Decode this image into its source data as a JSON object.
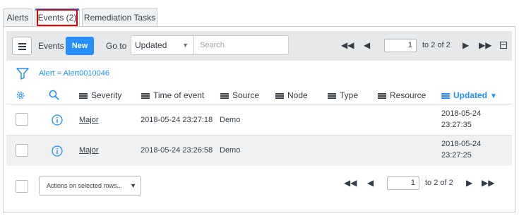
{
  "tabs": [
    {
      "label": "Alerts"
    },
    {
      "label": "Events (2)"
    },
    {
      "label": "Remediation Tasks"
    }
  ],
  "toolbar": {
    "list_title": "Events",
    "new_label": "New",
    "goto_label": "Go to",
    "goto_field": "Updated",
    "search_placeholder": "Search",
    "page_value": "1",
    "page_range": "to 2 of 2"
  },
  "filter": {
    "text": "Alert = Alert0010046"
  },
  "columns": [
    {
      "label": "Severity"
    },
    {
      "label": "Time of event"
    },
    {
      "label": "Source"
    },
    {
      "label": "Node"
    },
    {
      "label": "Type"
    },
    {
      "label": "Resource"
    },
    {
      "label": "Updated"
    }
  ],
  "rows": [
    {
      "severity": "Major",
      "time_of_event": "2018-05-24 23:27:18",
      "source": "Demo",
      "node": "",
      "type": "",
      "resource": "",
      "updated_date": "2018-05-24",
      "updated_time": "23:27:35"
    },
    {
      "severity": "Major",
      "time_of_event": "2018-05-24 23:26:58",
      "source": "Demo",
      "node": "",
      "type": "",
      "resource": "",
      "updated_date": "2018-05-24",
      "updated_time": "23:27:25"
    }
  ],
  "footer": {
    "actions_label": "Actions on selected rows...",
    "page_value": "1",
    "page_range": "to 2 of 2"
  },
  "colors": {
    "accent": "#278efc",
    "highlight": "#e00000",
    "toolbar_bg": "#e6e8ea"
  }
}
